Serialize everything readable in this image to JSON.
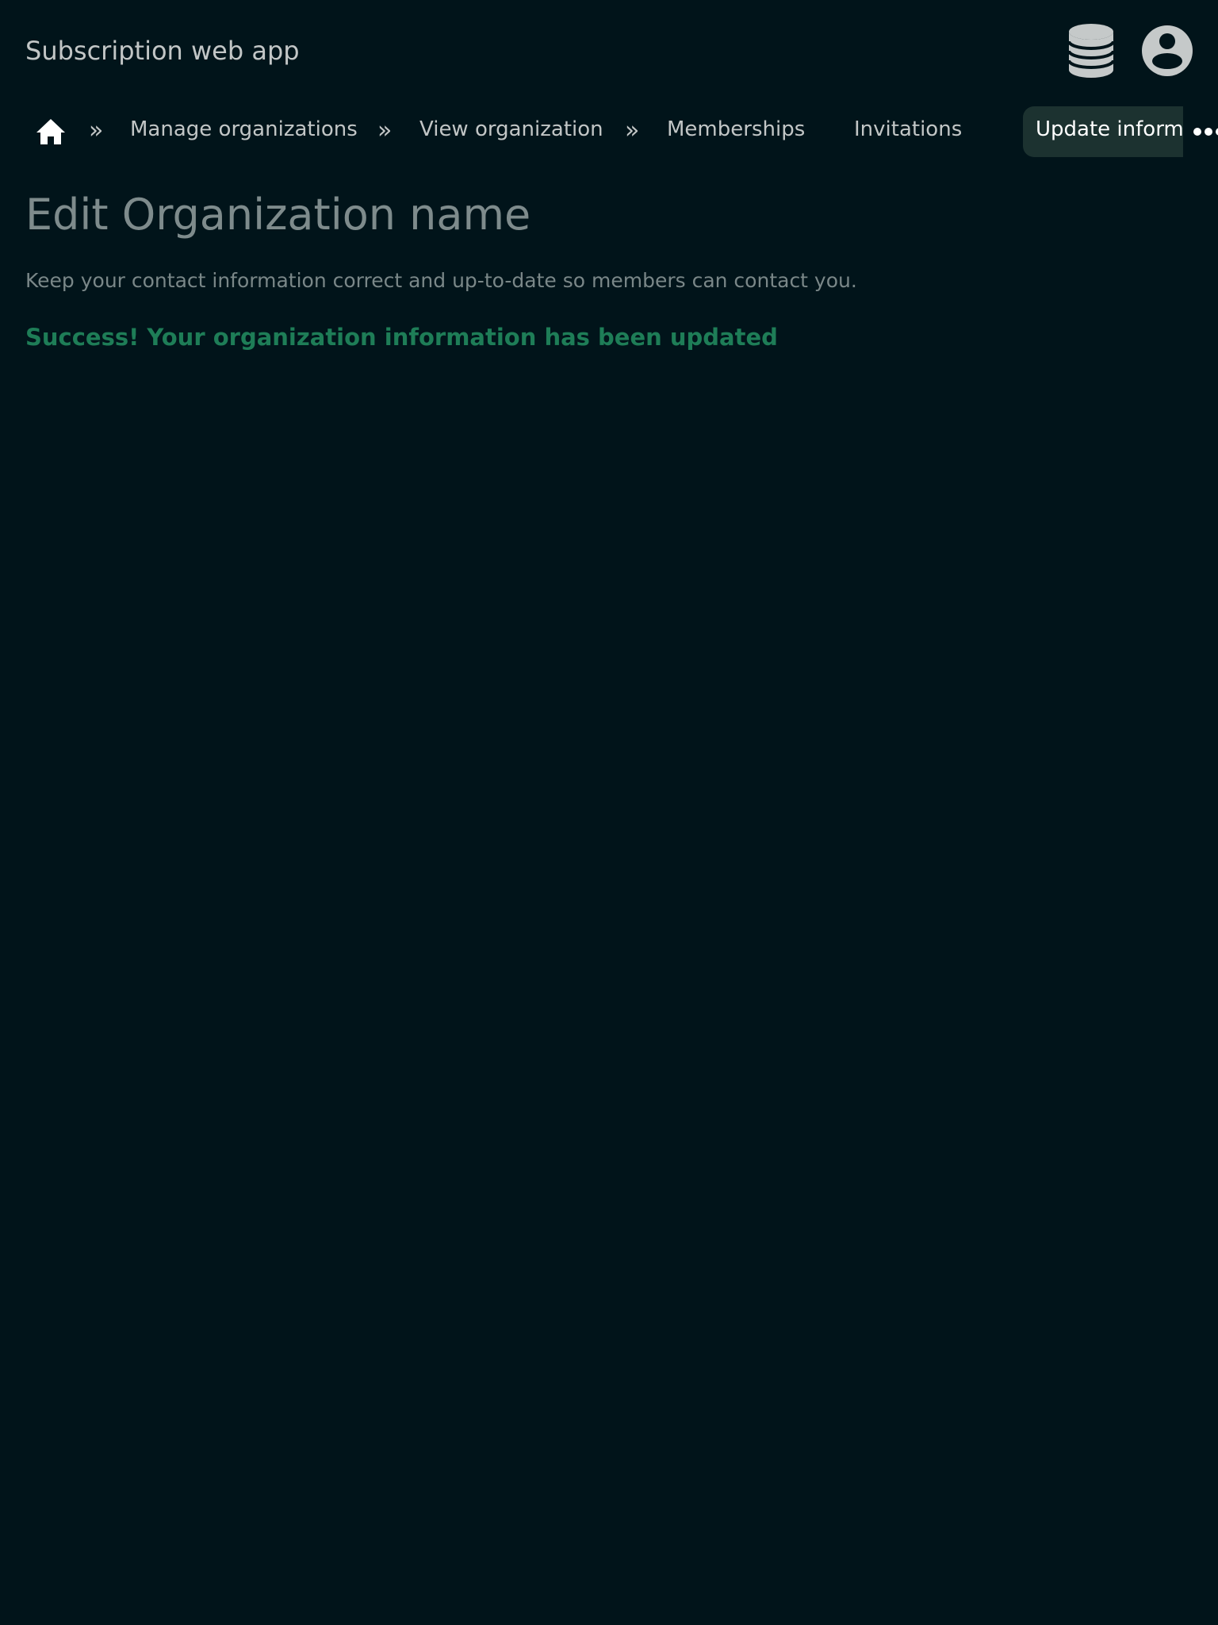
{
  "header": {
    "app_title": "Subscription web app",
    "db_icon": "database-icon",
    "user_icon": "user-circle-icon"
  },
  "nav": {
    "home_icon": "home-icon",
    "separator": "»",
    "items": [
      {
        "label": "Manage organizations"
      },
      {
        "label": "View organization"
      },
      {
        "label": "Memberships"
      },
      {
        "label": "Invitations"
      }
    ],
    "active_label": "Update information",
    "more_icon": "more-horizontal-icon"
  },
  "main": {
    "title": "Edit Organization name",
    "description": "Keep your contact information correct and up-to-date so members can contact you.",
    "success_message": "Success! Your organization information has been updated"
  },
  "colors": {
    "background": "#01141a",
    "active_tab_bg": "#1c3230",
    "success": "#1e7d57",
    "muted_text": "#7e8b8c",
    "icon": "#c5c9c9"
  }
}
